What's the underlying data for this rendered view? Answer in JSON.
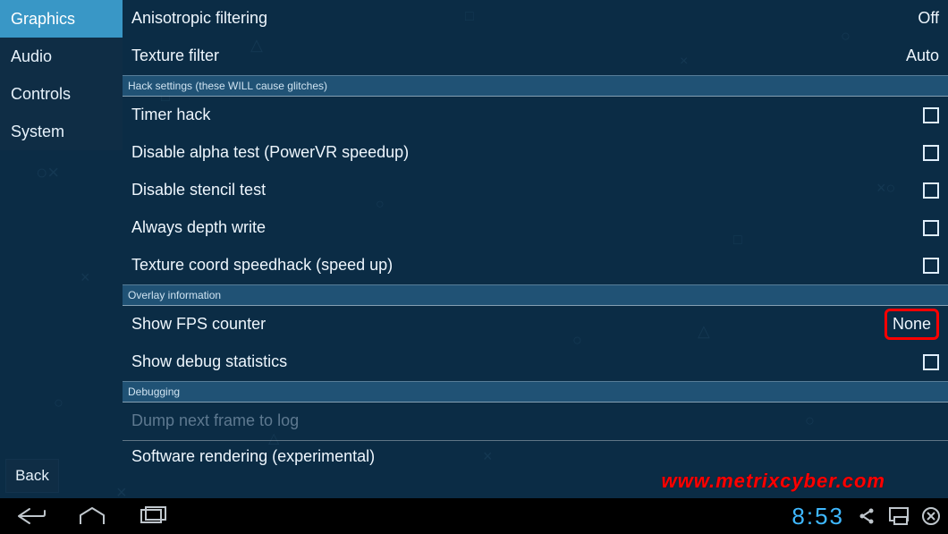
{
  "sidebar": {
    "items": [
      {
        "label": "Graphics",
        "active": true
      },
      {
        "label": "Audio",
        "active": false
      },
      {
        "label": "Controls",
        "active": false
      },
      {
        "label": "System",
        "active": false
      }
    ],
    "back_label": "Back"
  },
  "sections": {
    "hack": "Hack settings (these WILL cause glitches)",
    "overlay": "Overlay information",
    "debugging": "Debugging"
  },
  "rows": {
    "anisotropic": {
      "label": "Anisotropic filtering",
      "value": "Off"
    },
    "texture_filter": {
      "label": "Texture filter",
      "value": "Auto"
    },
    "timer_hack": {
      "label": "Timer hack"
    },
    "disable_alpha": {
      "label": "Disable alpha test (PowerVR speedup)"
    },
    "disable_stencil": {
      "label": "Disable stencil test"
    },
    "always_depth": {
      "label": "Always depth write"
    },
    "texcoord_speedhack": {
      "label": "Texture coord speedhack (speed up)"
    },
    "show_fps": {
      "label": "Show FPS counter",
      "value": "None"
    },
    "show_debug": {
      "label": "Show debug statistics"
    },
    "dump_next": {
      "label": "Dump next frame to log"
    },
    "software_rendering": {
      "label": "Software rendering (experimental)"
    }
  },
  "navbar": {
    "clock": "8:53"
  },
  "watermark": "www.metrixcyber.com",
  "icons": {
    "back": "back-icon",
    "home": "home-icon",
    "recent": "recent-icon",
    "share": "share-icon",
    "cast": "cast-icon",
    "close": "close-icon"
  },
  "colors": {
    "accent": "#3997c6",
    "highlight": "#ff0000",
    "clock": "#3fb8ff"
  }
}
